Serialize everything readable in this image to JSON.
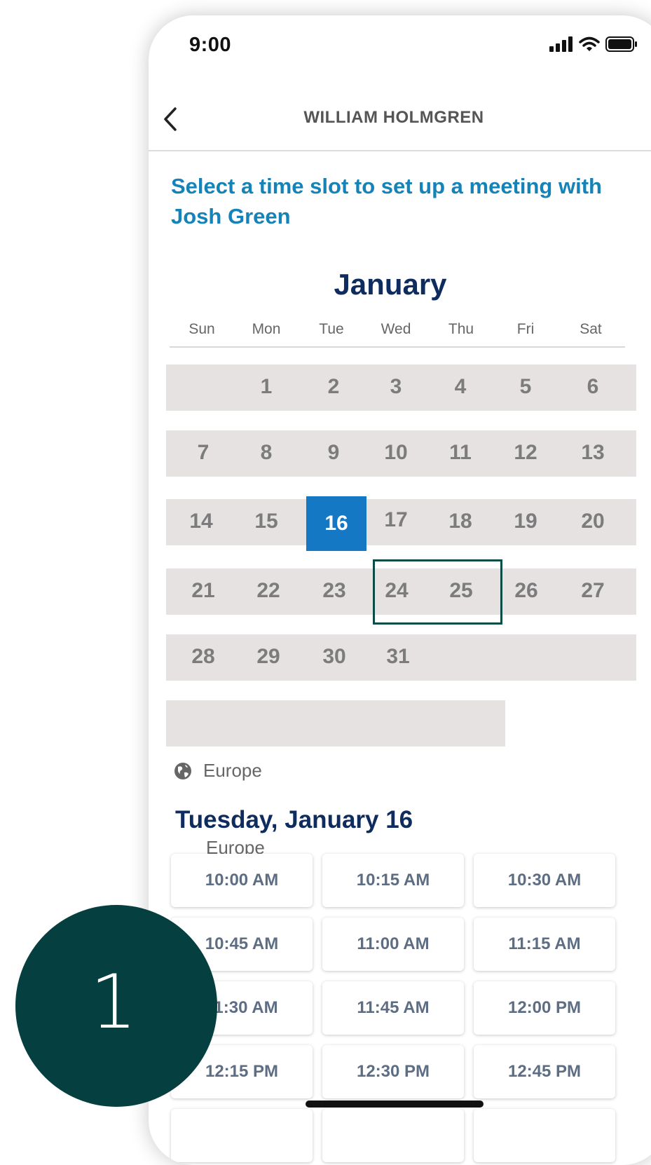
{
  "status_bar": {
    "time": "9:00",
    "icons": [
      "signal-icon",
      "wifi-icon",
      "battery-icon"
    ]
  },
  "nav": {
    "back_icon": "chevron-left-icon",
    "title": "WILLIAM HOLMGREN"
  },
  "headline": "Select a time slot to set up a meeting with Josh Green",
  "calendar": {
    "month": "January",
    "weekdays": [
      "Sun",
      "Mon",
      "Tue",
      "Wed",
      "Thu",
      "Fri",
      "Sat"
    ],
    "weeks": [
      [
        "",
        "1",
        "2",
        "3",
        "4",
        "5",
        "6"
      ],
      [
        "7",
        "8",
        "9",
        "10",
        "11",
        "12",
        "13"
      ],
      [
        "14",
        "15",
        "16",
        "17",
        "18",
        "19",
        "20"
      ],
      [
        "21",
        "22",
        "23",
        "24",
        "25",
        "26",
        "27"
      ],
      [
        "28",
        "29",
        "30",
        "31",
        "",
        "",
        ""
      ]
    ],
    "selected_day": "16",
    "highlighted_days": [
      "24",
      "25"
    ]
  },
  "timezone": {
    "label": "Europe",
    "icon": "globe-icon"
  },
  "selected_date": {
    "heading": "Tuesday, January 16",
    "timezone": "Europe"
  },
  "time_slots": [
    [
      "10:00 AM",
      "10:15 AM",
      "10:30 AM"
    ],
    [
      "10:45 AM",
      "11:00 AM",
      "11:15 AM"
    ],
    [
      "11:30 AM",
      "11:45 AM",
      "12:00 PM"
    ],
    [
      "12:15 PM",
      "12:30 PM",
      "12:45 PM"
    ]
  ],
  "step_badge": "1",
  "colors": {
    "accent": "#1683b8",
    "primary_dark": "#0f2c5e",
    "selected": "#1578c4",
    "badge": "#053f40",
    "band": "#e7e2e2"
  }
}
